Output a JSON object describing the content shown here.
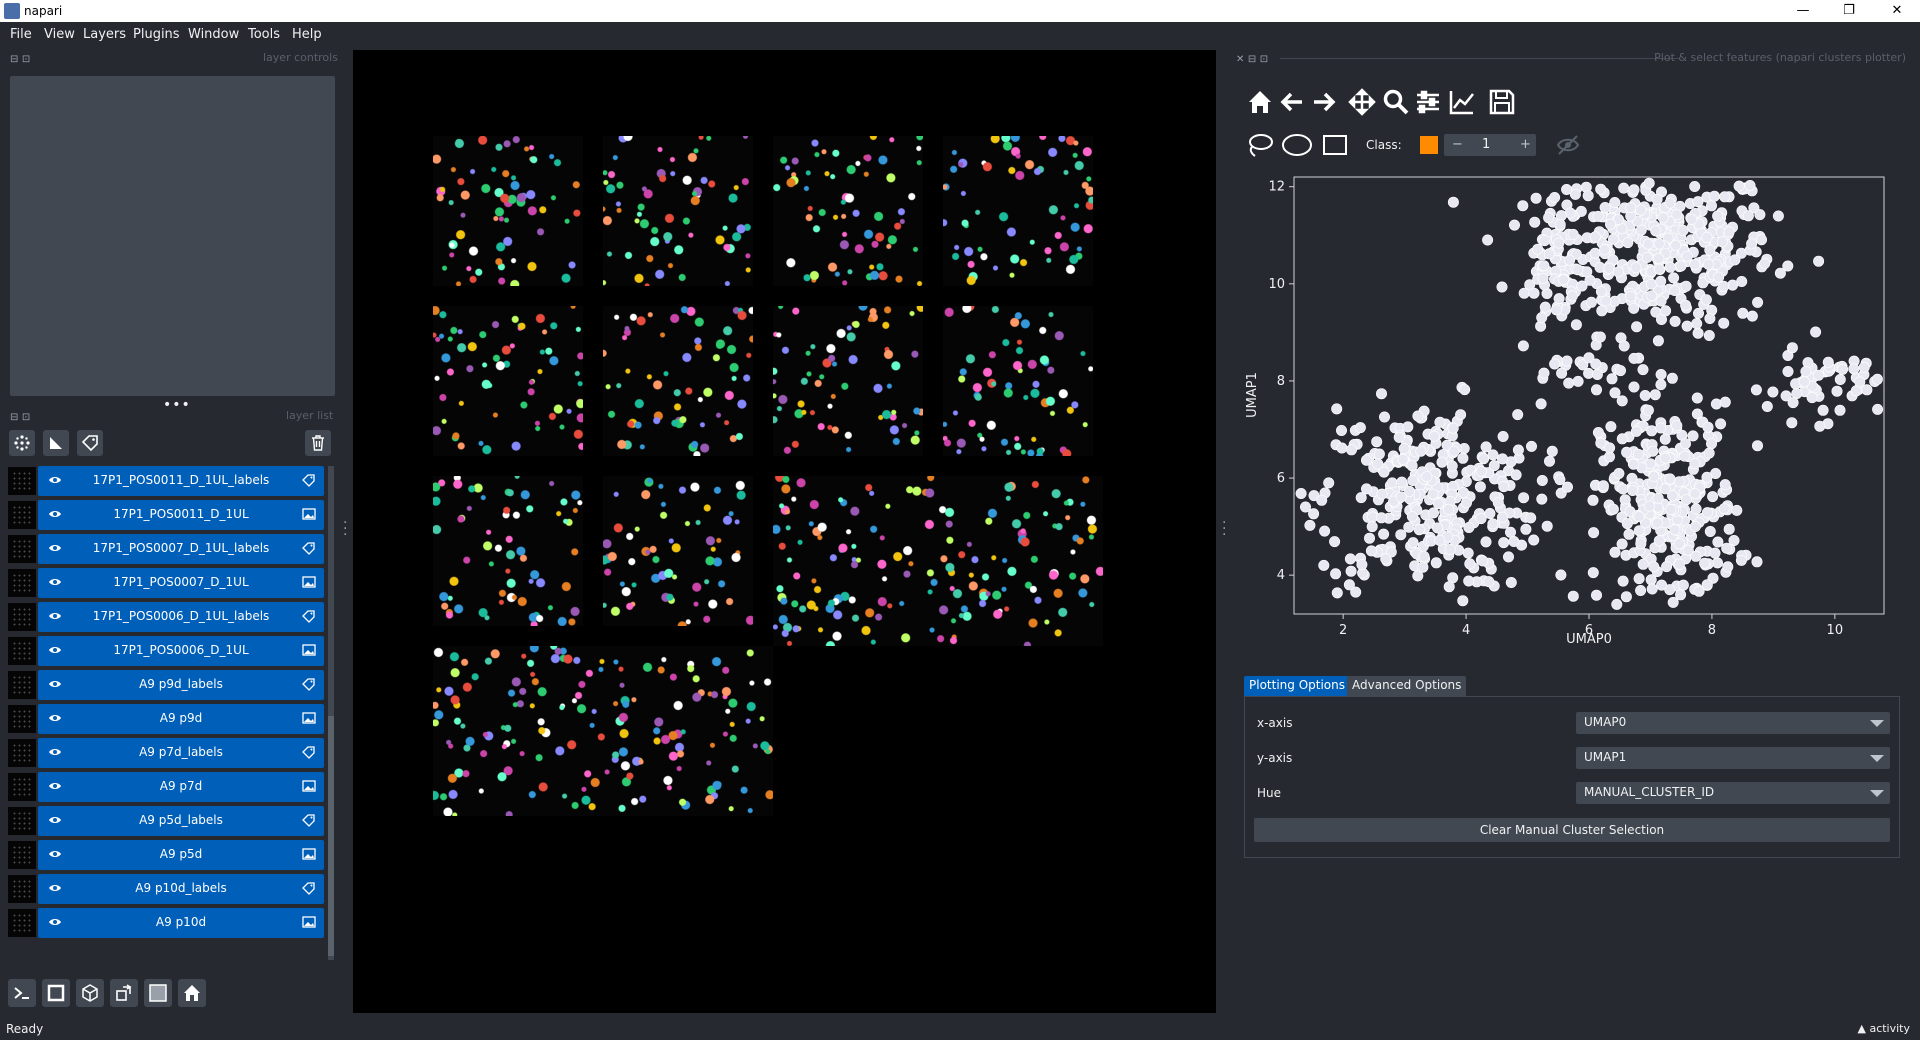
{
  "window": {
    "title": "napari",
    "minimize": "—",
    "maximize": "❐",
    "close": "✕"
  },
  "menu": [
    "File",
    "View",
    "Layers",
    "Plugins",
    "Window",
    "Tools",
    "Help"
  ],
  "left_dock": {
    "layer_controls_title": "layer controls",
    "layer_list_title": "layer list",
    "layers": [
      {
        "name": "17P1_POS0011_D_1UL_labels",
        "type": "labels"
      },
      {
        "name": "17P1_POS0011_D_1UL",
        "type": "image"
      },
      {
        "name": "17P1_POS0007_D_1UL_labels",
        "type": "labels"
      },
      {
        "name": "17P1_POS0007_D_1UL",
        "type": "image"
      },
      {
        "name": "17P1_POS0006_D_1UL_labels",
        "type": "labels"
      },
      {
        "name": "17P1_POS0006_D_1UL",
        "type": "image"
      },
      {
        "name": "A9 p9d_labels",
        "type": "labels"
      },
      {
        "name": "A9 p9d",
        "type": "image"
      },
      {
        "name": "A9 p7d_labels",
        "type": "labels"
      },
      {
        "name": "A9 p7d",
        "type": "image"
      },
      {
        "name": "A9 p5d_labels",
        "type": "labels"
      },
      {
        "name": "A9 p5d",
        "type": "image"
      },
      {
        "name": "A9 p10d_labels",
        "type": "labels"
      },
      {
        "name": "A9 p10d",
        "type": "image"
      }
    ]
  },
  "plotter": {
    "title": "Plot & select features (napari clusters plotter)",
    "class_label": "Class:",
    "class_value": "1",
    "class_color": "#ff8c00",
    "tabs": [
      "Plotting Options",
      "Advanced Options"
    ],
    "active_tab": "Plotting Options",
    "options": [
      {
        "label": "x-axis",
        "value": "UMAP0"
      },
      {
        "label": "y-axis",
        "value": "UMAP1"
      },
      {
        "label": "Hue",
        "value": "MANUAL_CLUSTER_ID"
      }
    ],
    "clear_button": "Clear Manual Cluster Selection"
  },
  "chart_data": {
    "type": "scatter",
    "xlabel": "UMAP0",
    "ylabel": "UMAP1",
    "xlim": [
      1.2,
      10.8
    ],
    "ylim": [
      3.2,
      12.2
    ],
    "xticks": [
      2,
      4,
      6,
      8,
      10
    ],
    "yticks": [
      4,
      6,
      8,
      10,
      12
    ],
    "point_color": "#e8e8f2",
    "clusters": [
      {
        "cx": 7.1,
        "cy": 10.7,
        "sx": 0.95,
        "sy": 0.85,
        "n": 420
      },
      {
        "cx": 5.5,
        "cy": 10.5,
        "sx": 0.25,
        "sy": 0.7,
        "n": 60
      },
      {
        "cx": 3.4,
        "cy": 5.6,
        "sx": 0.9,
        "sy": 0.95,
        "n": 330
      },
      {
        "cx": 7.3,
        "cy": 5.4,
        "sx": 0.55,
        "sy": 1.05,
        "n": 330
      },
      {
        "cx": 9.8,
        "cy": 7.9,
        "sx": 0.45,
        "sy": 0.35,
        "n": 60
      },
      {
        "cx": 6.0,
        "cy": 8.2,
        "sx": 0.5,
        "sy": 0.2,
        "n": 25
      }
    ]
  },
  "status": {
    "text": "Ready",
    "activity": "activity"
  }
}
